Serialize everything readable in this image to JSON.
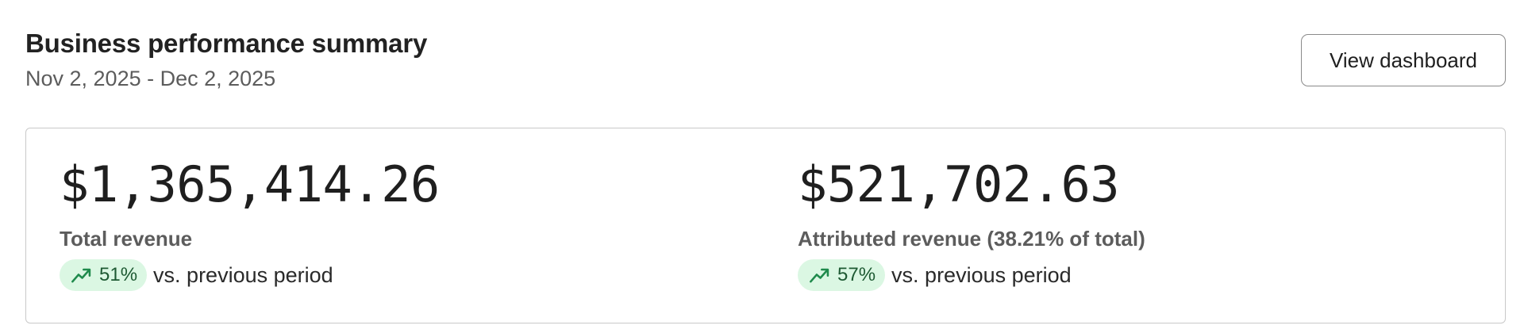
{
  "header": {
    "title": "Business performance summary",
    "date_range": "Nov 2, 2025 - Dec 2, 2025",
    "view_dashboard_label": "View dashboard"
  },
  "metrics": [
    {
      "value": "$1,365,414.26",
      "label": "Total revenue",
      "change": "51%",
      "change_direction": "up",
      "comparison_text": "vs. previous period"
    },
    {
      "value": "$521,702.63",
      "label": "Attributed revenue (38.21% of total)",
      "change": "57%",
      "change_direction": "up",
      "comparison_text": "vs. previous period"
    }
  ],
  "colors": {
    "positive_badge_bg": "#dbf7e3",
    "positive_icon": "#1f8a4c"
  },
  "icons": {
    "trend": "trending-up-icon"
  }
}
